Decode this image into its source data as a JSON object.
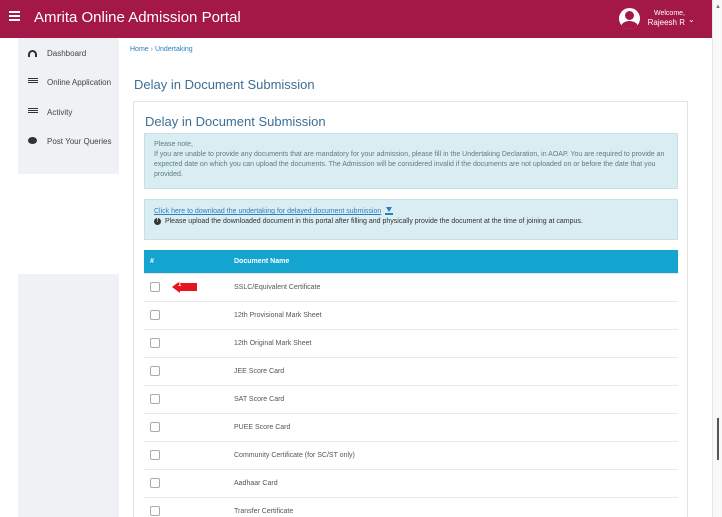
{
  "header": {
    "app_title": "Amrita Online Admission Portal",
    "welcome_label": "Welcome,",
    "user_name": "Rajeesh R",
    "brand_color": "#a31846"
  },
  "sidebar": {
    "items": [
      {
        "label": "Dashboard",
        "icon": "dashboard-icon"
      },
      {
        "label": "Online Application",
        "icon": "list-icon"
      },
      {
        "label": "Activity",
        "icon": "list-icon"
      },
      {
        "label": "Post Your Queries",
        "icon": "chat-icon"
      }
    ]
  },
  "breadcrumb": {
    "home": "Home",
    "separator": "›",
    "current": "Undertaking"
  },
  "page": {
    "title": "Delay in Document Submission"
  },
  "card": {
    "title": "Delay in Document Submission",
    "notice_heading": "Please note,",
    "notice_body": "If you are unable to provide any documents that are mandatory for your admission, please fill in the Undertaking Declaration, in AOAP. You are required to provide an expected date on which you can upload the documents. The Admission will be considered invalid if the documents are not uploaded on or before the date that you provided.",
    "download_link": "Click here to download the undertaking for delayed document submission",
    "download_hint": "Please upload the downloaded document in this portal after filling and physically provide the document at the time of joining at campus."
  },
  "table": {
    "headers": [
      "#",
      "Document Name"
    ],
    "rows": [
      "SSLC/Equivalent Certificate",
      "12th Provisional Mark Sheet",
      "12th Original Mark Sheet",
      "JEE Score Card",
      "SAT Score Card",
      "PUEE Score Card",
      "Community Certificate (for SC/ST only)",
      "Aadhaar Card",
      "Transfer Certificate"
    ]
  },
  "annotation": {
    "marker_number": "1",
    "color": "#e8141d"
  }
}
